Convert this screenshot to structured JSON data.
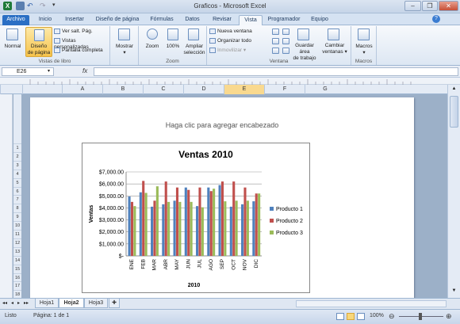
{
  "window": {
    "title": "Graficos - Microsoft Excel"
  },
  "tabs": [
    {
      "label": "Archivo",
      "kind": "file"
    },
    {
      "label": "Inicio",
      "kind": ""
    },
    {
      "label": "Insertar",
      "kind": ""
    },
    {
      "label": "Diseño de página",
      "kind": ""
    },
    {
      "label": "Fórmulas",
      "kind": ""
    },
    {
      "label": "Datos",
      "kind": ""
    },
    {
      "label": "Revisar",
      "kind": ""
    },
    {
      "label": "Vista",
      "kind": "active"
    },
    {
      "label": "Programador",
      "kind": ""
    },
    {
      "label": "Equipo",
      "kind": ""
    }
  ],
  "ribbon": {
    "vistas": {
      "normal": "Normal",
      "diseno_line1": "Diseño",
      "diseno_line2": "de página",
      "ver_salt": "Ver salt. Pág.",
      "personalizadas": "Vistas personalizadas",
      "pantalla": "Pantalla completa",
      "label": "Vistas de libro"
    },
    "mostrar": {
      "label": "Mostrar"
    },
    "zoom": {
      "zoom": "Zoom",
      "cien": "100%",
      "ampliar1": "Ampliar",
      "ampliar2": "selección",
      "label": "Zoom"
    },
    "ventana": {
      "nueva": "Nueva ventana",
      "organizar": "Organizar todo",
      "inmovilizar": "Inmovilizar",
      "guardar1": "Guardar área",
      "guardar2": "de trabajo",
      "cambiar1": "Cambiar",
      "cambiar2": "ventanas",
      "label": "Ventana"
    },
    "macros": {
      "btn": "Macros",
      "label": "Macros"
    }
  },
  "formula_bar": {
    "name_box": "E26",
    "fx": "fx",
    "value": ""
  },
  "columns": [
    "A",
    "B",
    "C",
    "D",
    "E",
    "F",
    "G"
  ],
  "selected_column": "E",
  "rows": [
    "1",
    "2",
    "3",
    "4",
    "5",
    "6",
    "7",
    "8",
    "9",
    "10",
    "11",
    "12",
    "13",
    "14",
    "15",
    "16",
    "17",
    "18"
  ],
  "page_header_placeholder": "Haga clic para agregar encabezado",
  "chart_data": {
    "type": "bar",
    "title": "Ventas 2010",
    "xlabel": "2010",
    "ylabel": "Ventas",
    "ylim": [
      0,
      7000
    ],
    "y_ticks": [
      "$-",
      "$1,000.00",
      "$2,000.00",
      "$3,000.00",
      "$4,000.00",
      "$5,000.00",
      "$6,000.00",
      "$7,000.00"
    ],
    "categories": [
      "ENE",
      "FEB",
      "MAR",
      "ABR",
      "MAY",
      "JUN",
      "JUL",
      "AGO",
      "SEP",
      "OCT",
      "NOV",
      "DIC"
    ],
    "series": [
      {
        "name": "Producto 1",
        "color": "#4f81bd",
        "values": [
          4950,
          5300,
          4100,
          4300,
          4600,
          5700,
          4150,
          5700,
          5900,
          4100,
          4300,
          4550
        ]
      },
      {
        "name": "Producto 2",
        "color": "#c0504d",
        "values": [
          4500,
          6250,
          4600,
          6200,
          5700,
          5500,
          5700,
          5400,
          6200,
          6200,
          5700,
          5200
        ]
      },
      {
        "name": "Producto 3",
        "color": "#9bbb59",
        "values": [
          4150,
          5250,
          5800,
          4500,
          4500,
          4500,
          4050,
          5600,
          4550,
          4600,
          4600,
          5200
        ]
      }
    ],
    "legend": "right",
    "grid": true
  },
  "sheet_tabs": [
    "Hoja1",
    "Hoja2",
    "Hoja3"
  ],
  "active_sheet": "Hoja2",
  "status": {
    "ready": "Listo",
    "page": "Página: 1 de 1",
    "zoom": "100%"
  }
}
